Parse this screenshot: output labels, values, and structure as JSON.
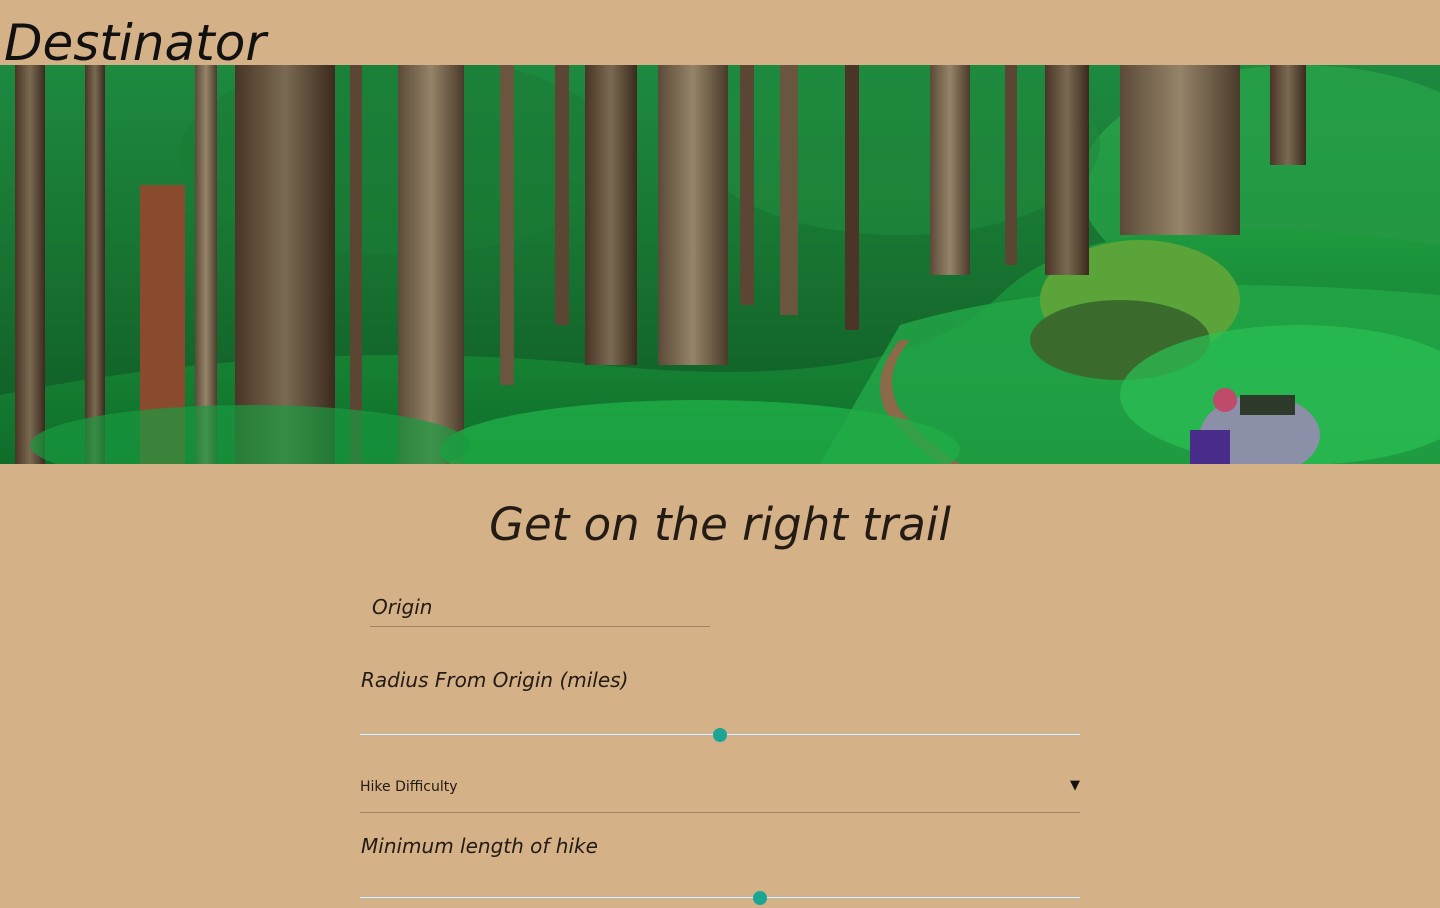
{
  "header": {
    "brand": "Destinator"
  },
  "hero": {
    "alt": "Forest trail with hiker"
  },
  "main": {
    "headline": "Get on the right trail",
    "origin": {
      "placeholder": "Origin",
      "value": ""
    },
    "radius": {
      "label": "Radius From Origin (miles)",
      "value_fraction": 0.5
    },
    "difficulty": {
      "selected": "Hike Difficulty",
      "caret_icon": "caret-down-icon"
    },
    "min_length": {
      "label": "Minimum length of hike",
      "value_fraction": 0.555
    }
  },
  "colors": {
    "background": "#d4b187",
    "accent": "#1aa595"
  }
}
